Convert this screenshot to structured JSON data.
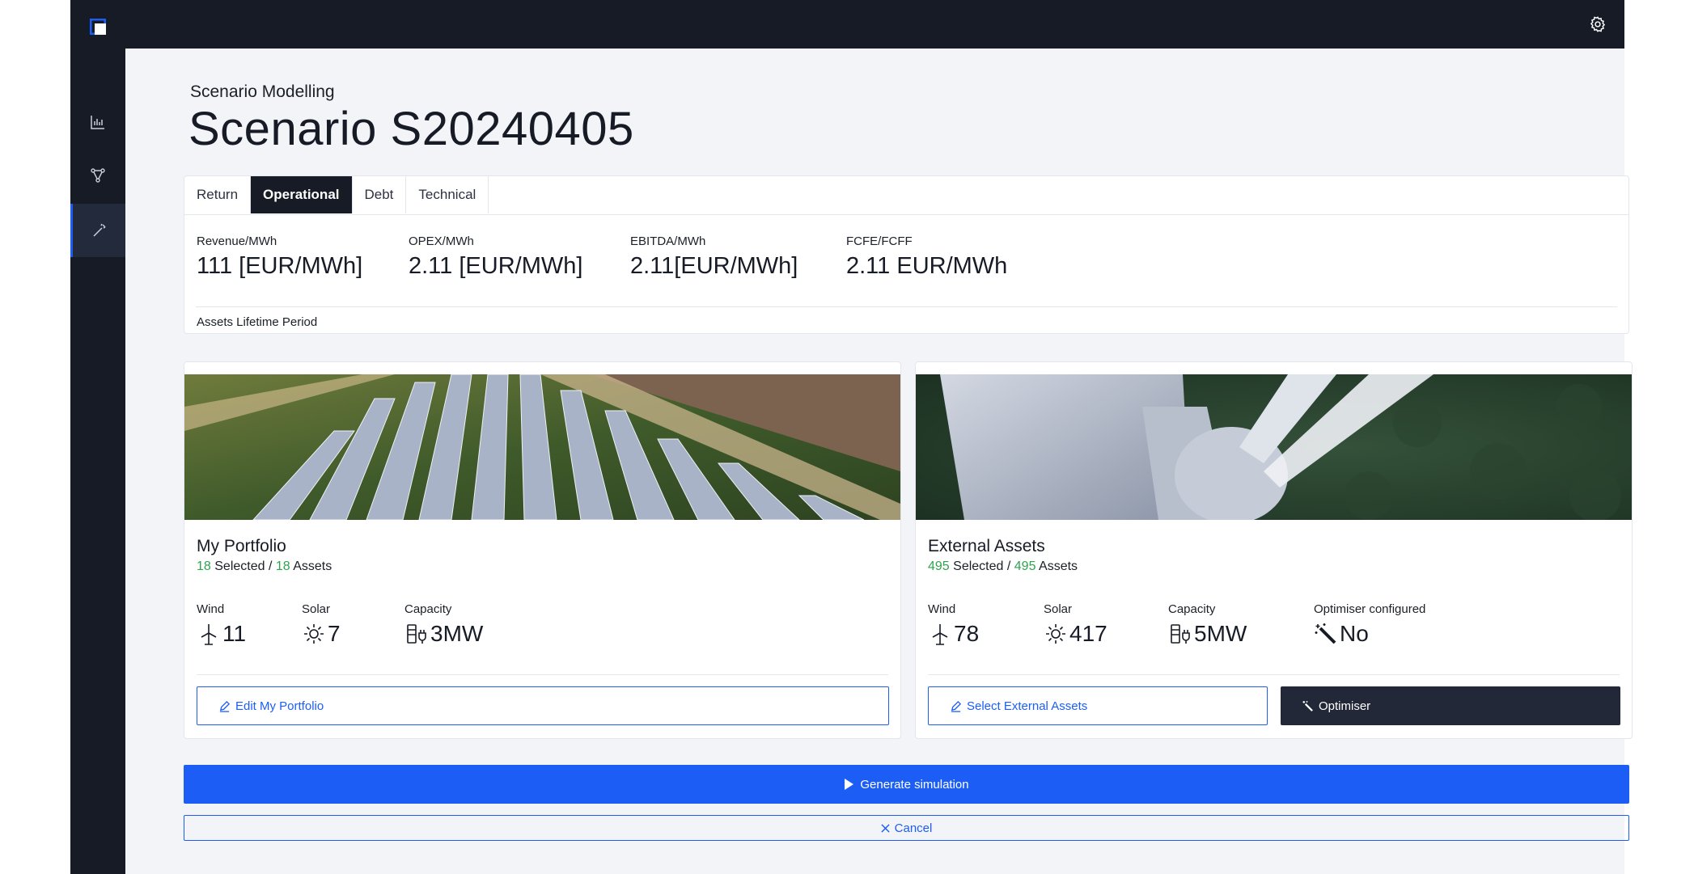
{
  "colors": {
    "accent": "#1c5ef5",
    "dark": "#161b25",
    "green": "#2ea44f",
    "background": "#f2f4f8"
  },
  "icons": {
    "logo": "app-logo-icon",
    "settings": "gear-icon",
    "sidebar": [
      "bar-chart-icon",
      "network-icon",
      "wand-icon"
    ],
    "wind": "wind-turbine-icon",
    "solar": "sun-icon",
    "capacity": "plug-icon",
    "optimiser": "magic-wand-icon"
  },
  "header": {
    "breadcrumb": "Scenario Modelling",
    "title": "Scenario S20240405"
  },
  "tabs": [
    {
      "label": "Return",
      "active": false
    },
    {
      "label": "Operational",
      "active": true
    },
    {
      "label": "Debt",
      "active": false
    },
    {
      "label": "Technical",
      "active": false
    }
  ],
  "kpis": [
    {
      "label": "Revenue/MWh",
      "value": "111 [EUR/MWh]"
    },
    {
      "label": "OPEX/MWh",
      "value": "2.11 [EUR/MWh]"
    },
    {
      "label": "EBITDA/MWh",
      "value": "2.11[EUR/MWh]"
    },
    {
      "label": "FCFE/FCFF",
      "value": "2.11 EUR/MWh"
    }
  ],
  "lifetime_label": "Assets Lifetime Period",
  "portfolio": {
    "title": "My Portfolio",
    "selected": "18",
    "selected_text": "Selected /",
    "total": "18",
    "total_text": "Assets",
    "stats": [
      {
        "label": "Wind",
        "value": "11"
      },
      {
        "label": "Solar",
        "value": "7"
      },
      {
        "label": "Capacity",
        "value": "3MW"
      }
    ],
    "edit_button": "Edit My Portfolio"
  },
  "external": {
    "title": "External Assets",
    "selected": "495",
    "selected_text": "Selected /",
    "total": "495",
    "total_text": "Assets",
    "stats": [
      {
        "label": "Wind",
        "value": "78"
      },
      {
        "label": "Solar",
        "value": "417"
      },
      {
        "label": "Capacity",
        "value": "5MW"
      },
      {
        "label": "Optimiser configured",
        "value": "No"
      }
    ],
    "select_button": "Select External Assets",
    "optimiser_button": "Optimiser"
  },
  "actions": {
    "generate": "Generate simulation",
    "cancel": "Cancel"
  }
}
